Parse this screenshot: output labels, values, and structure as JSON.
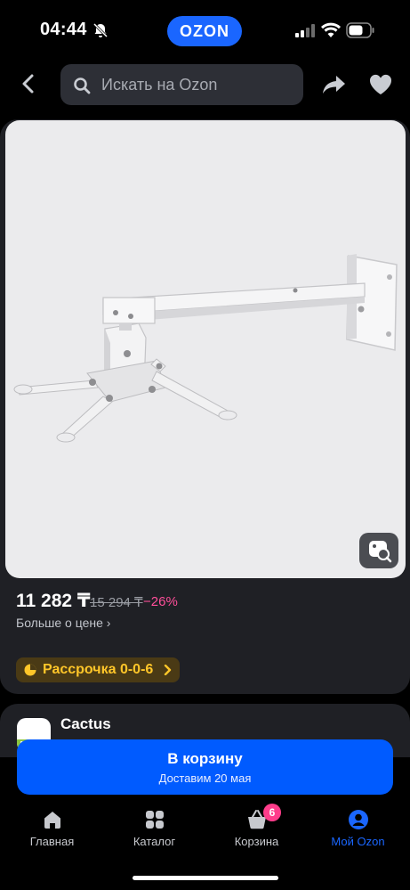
{
  "status_bar": {
    "time": "04:44",
    "brand": "OZON"
  },
  "header": {
    "search_placeholder": "Искать на Ozon",
    "icons": [
      "back-icon",
      "search-icon",
      "share-icon",
      "heart-icon"
    ]
  },
  "product": {
    "price": "11 282 ₸",
    "old_price": "15 294 ₸",
    "discount": "−26%",
    "price_more": "Больше о цене ›",
    "installment": "Рассрочка 0-0-6"
  },
  "seller": {
    "name": "Cactus"
  },
  "cart_button": {
    "label": "В корзину",
    "delivery": "Доставим 20 мая"
  },
  "tabbar": {
    "items": [
      {
        "label": "Главная",
        "icon": "home-icon"
      },
      {
        "label": "Каталог",
        "icon": "catalog-icon"
      },
      {
        "label": "Корзина",
        "icon": "cart-icon",
        "badge": "6"
      },
      {
        "label": "Мой Ozon",
        "icon": "profile-icon",
        "active": true
      }
    ]
  },
  "colors": {
    "accent": "#005bff",
    "discount": "#ff4f9a",
    "installment": "#ffc629",
    "card_bg": "#1f2025",
    "photo_bg": "#ebebed"
  }
}
